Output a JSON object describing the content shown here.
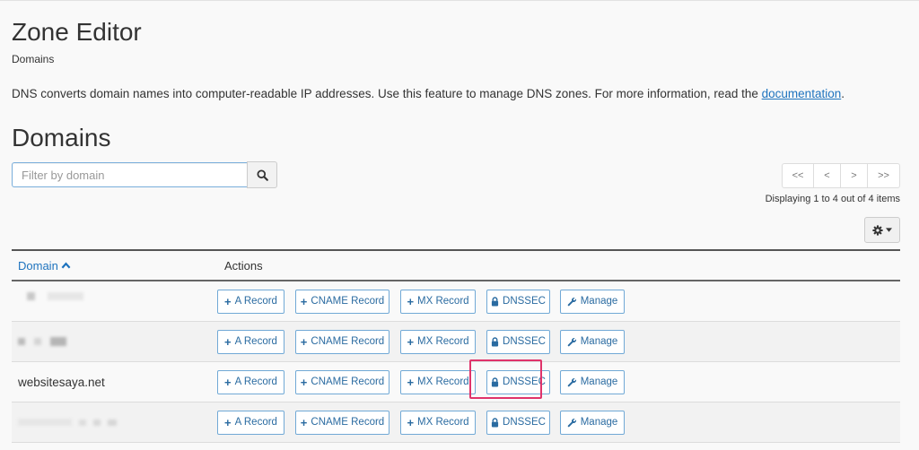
{
  "header": {
    "title": "Zone Editor",
    "breadcrumb": "Domains",
    "description_text": "DNS converts domain names into computer-readable IP addresses. Use this feature to manage DNS zones. For more information, read the ",
    "description_link": "documentation",
    "description_end": "."
  },
  "section": {
    "title": "Domains"
  },
  "search": {
    "placeholder": "Filter by domain",
    "value": ""
  },
  "pagination": {
    "first": "<<",
    "prev": "<",
    "next": ">",
    "last": ">>",
    "status": "Displaying 1 to 4 out of 4 items"
  },
  "table": {
    "headers": {
      "domain": "Domain",
      "actions": "Actions"
    },
    "actions": {
      "a_record": "A Record",
      "cname_record": "CNAME Record",
      "mx_record": "MX Record",
      "dnssec": "DNSSEC",
      "manage": "Manage"
    },
    "rows": [
      {
        "domain": "",
        "redacted": true
      },
      {
        "domain": "",
        "redacted": true
      },
      {
        "domain": "websitesaya.net",
        "redacted": false
      },
      {
        "domain": "",
        "redacted": true
      }
    ]
  },
  "colors": {
    "accent": "#1e73be",
    "highlight": "#e0336a",
    "button_border": "#71a9d6"
  },
  "icons": {
    "search": "magnifier",
    "settings": "gear",
    "sort": "chevron-up",
    "add": "plus",
    "dnssec": "lock",
    "manage": "wrench"
  }
}
